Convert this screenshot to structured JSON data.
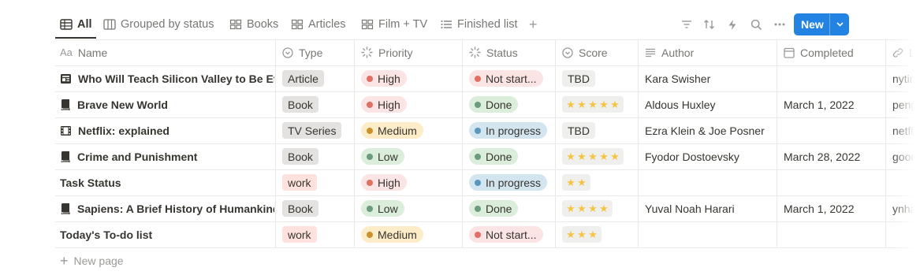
{
  "views": {
    "tabs": [
      {
        "label": "All",
        "icon": "table-icon",
        "active": true
      },
      {
        "label": "Grouped by status",
        "icon": "board-icon"
      },
      {
        "label": "Books",
        "icon": "gallery-icon"
      },
      {
        "label": "Articles",
        "icon": "gallery-icon"
      },
      {
        "label": "Film + TV",
        "icon": "gallery-icon"
      },
      {
        "label": "Finished list",
        "icon": "list-icon"
      }
    ],
    "add_view": "+"
  },
  "toolbar": {
    "new_label": "New",
    "icons": [
      "filter-icon",
      "sort-icon",
      "automation-icon",
      "search-icon",
      "more-icon"
    ]
  },
  "table": {
    "columns": [
      {
        "label": "Name",
        "icon": "title-icon",
        "icon_text": "Aa"
      },
      {
        "label": "Type",
        "icon": "select-icon"
      },
      {
        "label": "Priority",
        "icon": "status-icon"
      },
      {
        "label": "Status",
        "icon": "status-icon"
      },
      {
        "label": "Score",
        "icon": "select-icon"
      },
      {
        "label": "Author",
        "icon": "text-icon"
      },
      {
        "label": "Completed",
        "icon": "calendar-icon"
      },
      {
        "label": "Li",
        "icon": "link-icon"
      }
    ],
    "rows": [
      {
        "name": "Who Will Teach Silicon Valley to Be Eth",
        "page_icon": "article-icon",
        "type": "Article",
        "type_color": "#e3e2e0",
        "priority": "High",
        "priority_color": "#fbe4e4",
        "priority_dot": "#e16f64",
        "status": "Not start...",
        "status_color": "#fbe4e4",
        "status_dot": "#e16f64",
        "score": "TBD",
        "score_stars": 0,
        "author": "Kara Swisher",
        "completed": "",
        "link": "nytim"
      },
      {
        "name": "Brave New World",
        "page_icon": "book-icon",
        "type": "Book",
        "type_color": "#e3e2e0",
        "priority": "High",
        "priority_color": "#fbe4e4",
        "priority_dot": "#e16f64",
        "status": "Done",
        "status_color": "#dbeddb",
        "status_dot": "#6c9b7d",
        "score": "",
        "score_stars": 5,
        "author": "Aldous Huxley",
        "completed": "March 1, 2022",
        "link": "pengu"
      },
      {
        "name": "Netflix: explained",
        "page_icon": "film-icon",
        "type": "TV Series",
        "type_color": "#e3e2e0",
        "priority": "Medium",
        "priority_color": "#fdecc8",
        "priority_dot": "#cb912f",
        "status": "In progress",
        "status_color": "#d3e5ef",
        "status_dot": "#5b97bd",
        "score": "TBD",
        "score_stars": 0,
        "author": "Ezra Klein & Joe Posner",
        "completed": "",
        "link": "netfli"
      },
      {
        "name": "Crime and Punishment",
        "page_icon": "book-icon",
        "type": "Book",
        "type_color": "#e3e2e0",
        "priority": "Low",
        "priority_color": "#dbeddb",
        "priority_dot": "#6c9b7d",
        "status": "Done",
        "status_color": "#dbeddb",
        "status_dot": "#6c9b7d",
        "score": "",
        "score_stars": 5,
        "author": "Fyodor Dostoevsky",
        "completed": "March 28, 2022",
        "link": "good"
      },
      {
        "name": "Task Status",
        "page_icon": "",
        "type": "work",
        "type_color": "#ffe2dd",
        "priority": "High",
        "priority_color": "#fbe4e4",
        "priority_dot": "#e16f64",
        "status": "In progress",
        "status_color": "#d3e5ef",
        "status_dot": "#5b97bd",
        "score": "",
        "score_stars": 2,
        "author": "",
        "completed": "",
        "link": ""
      },
      {
        "name": "Sapiens: A Brief History of Humankind",
        "page_icon": "book-icon",
        "type": "Book",
        "type_color": "#e3e2e0",
        "priority": "Low",
        "priority_color": "#dbeddb",
        "priority_dot": "#6c9b7d",
        "status": "Done",
        "status_color": "#dbeddb",
        "status_dot": "#6c9b7d",
        "score": "",
        "score_stars": 4,
        "author": "Yuval Noah Harari",
        "completed": "March 1, 2022",
        "link": "ynhar"
      },
      {
        "name": "Today's To-do list",
        "page_icon": "",
        "type": "work",
        "type_color": "#ffe2dd",
        "priority": "Medium",
        "priority_color": "#fdecc8",
        "priority_dot": "#cb912f",
        "status": "Not start...",
        "status_color": "#fbe4e4",
        "status_dot": "#e16f64",
        "score": "",
        "score_stars": 3,
        "author": "",
        "completed": "",
        "link": ""
      }
    ],
    "new_page_label": "New page"
  }
}
